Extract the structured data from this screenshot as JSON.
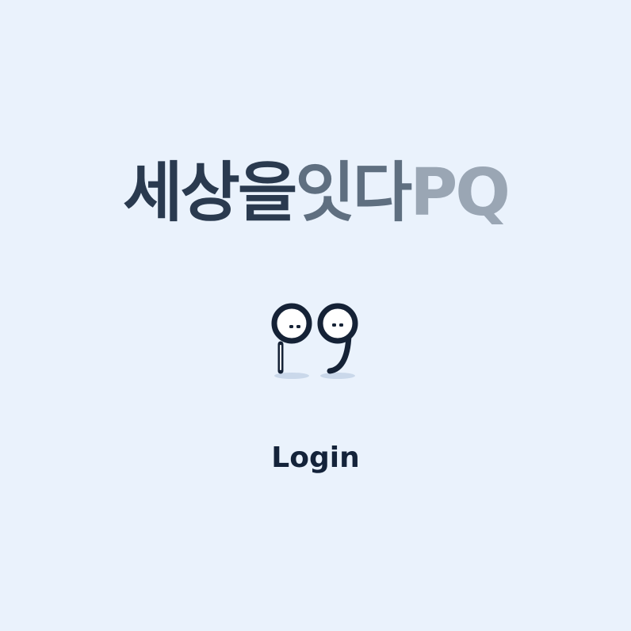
{
  "app": {
    "title_parts": [
      {
        "text": "세상을",
        "color": "#2a3a4f"
      },
      {
        "text": "잇다",
        "color": "#5f6f80"
      },
      {
        "text": "PQ",
        "color": "#9aa6b4"
      }
    ]
  },
  "logo": {
    "icon": "pq-mascot-icon",
    "colors": {
      "outline": "#152236",
      "face": "#ffffff",
      "shadow": "#b4c6dd"
    }
  },
  "login": {
    "label": "Login"
  }
}
